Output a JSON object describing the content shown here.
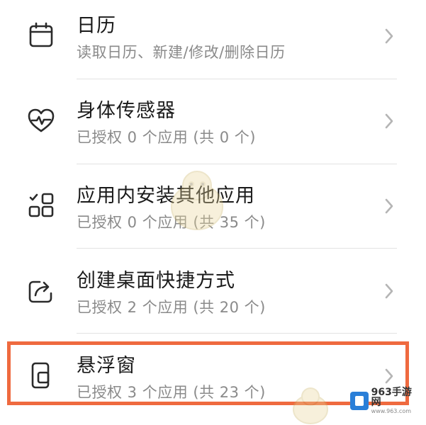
{
  "permissions": [
    {
      "icon": "calendar-icon",
      "title": "日历",
      "subtitle": "读取日历、新建/修改/删除日历"
    },
    {
      "icon": "heart-rate-icon",
      "title": "身体传感器",
      "subtitle": "已授权 0 个应用 (共 0 个)"
    },
    {
      "icon": "apps-grid-icon",
      "title": "应用内安装其他应用",
      "subtitle": "已授权 0 个应用 (共 35 个)"
    },
    {
      "icon": "share-shortcut-icon",
      "title": "创建桌面快捷方式",
      "subtitle": "已授权 2 个应用 (共 20 个)"
    },
    {
      "icon": "floating-window-icon",
      "title": "悬浮窗",
      "subtitle": "已授权 3 个应用 (共 23 个)"
    }
  ],
  "watermark": {
    "main": "963手游网",
    "sub": "www.963.com"
  },
  "colors": {
    "highlight": "#ef6a3f",
    "icon": "#2b2b2b",
    "chevron": "#b5b5b5"
  }
}
